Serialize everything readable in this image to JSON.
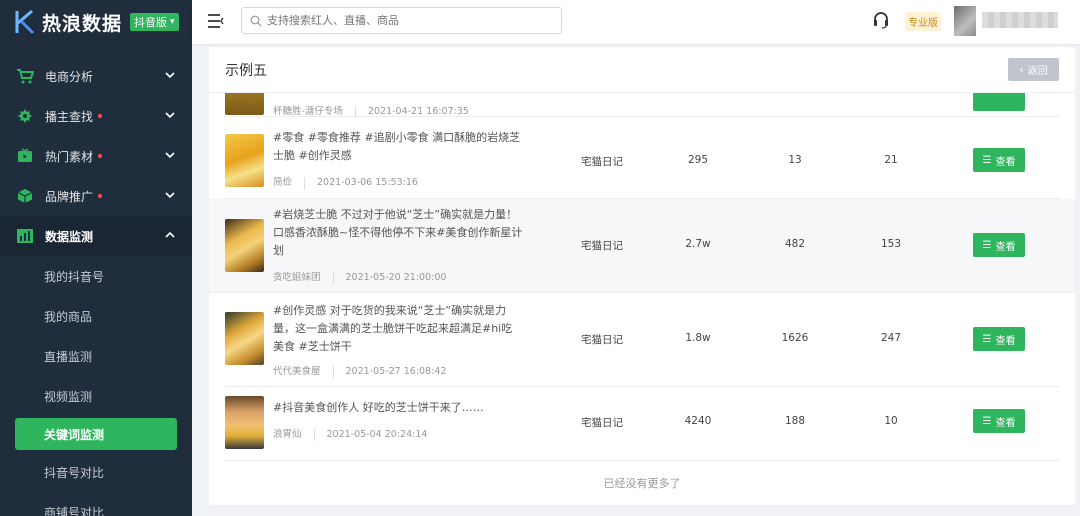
{
  "brand": {
    "name": "热浪数据",
    "badge": "抖音版"
  },
  "nav": [
    {
      "label": "电商分析",
      "dot": false
    },
    {
      "label": "播主查找",
      "dot": true
    },
    {
      "label": "热门素材",
      "dot": true
    },
    {
      "label": "品牌推广",
      "dot": true
    },
    {
      "label": "数据监测",
      "dot": false
    }
  ],
  "subnav": [
    "我的抖音号",
    "我的商品",
    "直播监测",
    "视频监测",
    "关键词监测",
    "抖音号对比",
    "商铺号对比"
  ],
  "search": {
    "placeholder": "支持搜索红人、直播、商品"
  },
  "header": {
    "plan": "专业版"
  },
  "card": {
    "title": "示例五",
    "back": "返回"
  },
  "rows": [
    {
      "desc": "",
      "author": "杯糖胜-溏仔专场",
      "time": "2021-04-21 16:07:35",
      "source": "",
      "plays": "",
      "likes": "",
      "comments": ""
    },
    {
      "desc": "#零食 #零食推荐 #追剧小零食 满口酥脆的岩烧芝士脆 #创作灵感",
      "author": "简俭",
      "time": "2021-03-06 15:53:16",
      "source": "宅猫日记",
      "plays": "295",
      "likes": "13",
      "comments": "21"
    },
    {
      "desc": "#岩烧芝士脆 不过对于他说“芝士”确实就是力量！口感香浓酥脆~怪不得他停不下来#美食创作新星计划",
      "author": "贪吃姐妹团",
      "time": "2021-05-20 21:00:00",
      "source": "宅猫日记",
      "plays": "2.7w",
      "likes": "482",
      "comments": "153"
    },
    {
      "desc": "#创作灵感 对于吃货的我来说“芝士”确实就是力量，这一盒满满的芝士脆饼干吃起来超满足#hi吃美食 #芝士饼干",
      "author": "代代美食屋",
      "time": "2021-05-27 16:08:42",
      "source": "宅猫日记",
      "plays": "1.8w",
      "likes": "1626",
      "comments": "247"
    },
    {
      "desc": "#抖音美食创作人 好吃的芝士饼干来了……",
      "author": "浪胃仙",
      "time": "2021-05-04 20:24:14",
      "source": "宅猫日记",
      "plays": "4240",
      "likes": "188",
      "comments": "10"
    }
  ],
  "view_label": "查看",
  "footer": {
    "no_more": "已经没有更多了"
  },
  "colors": {
    "sidebar": "#1f2d3d",
    "accent": "#2fb55d",
    "badge_bg": "#fff2d6",
    "badge_text": "#c88a1a"
  }
}
